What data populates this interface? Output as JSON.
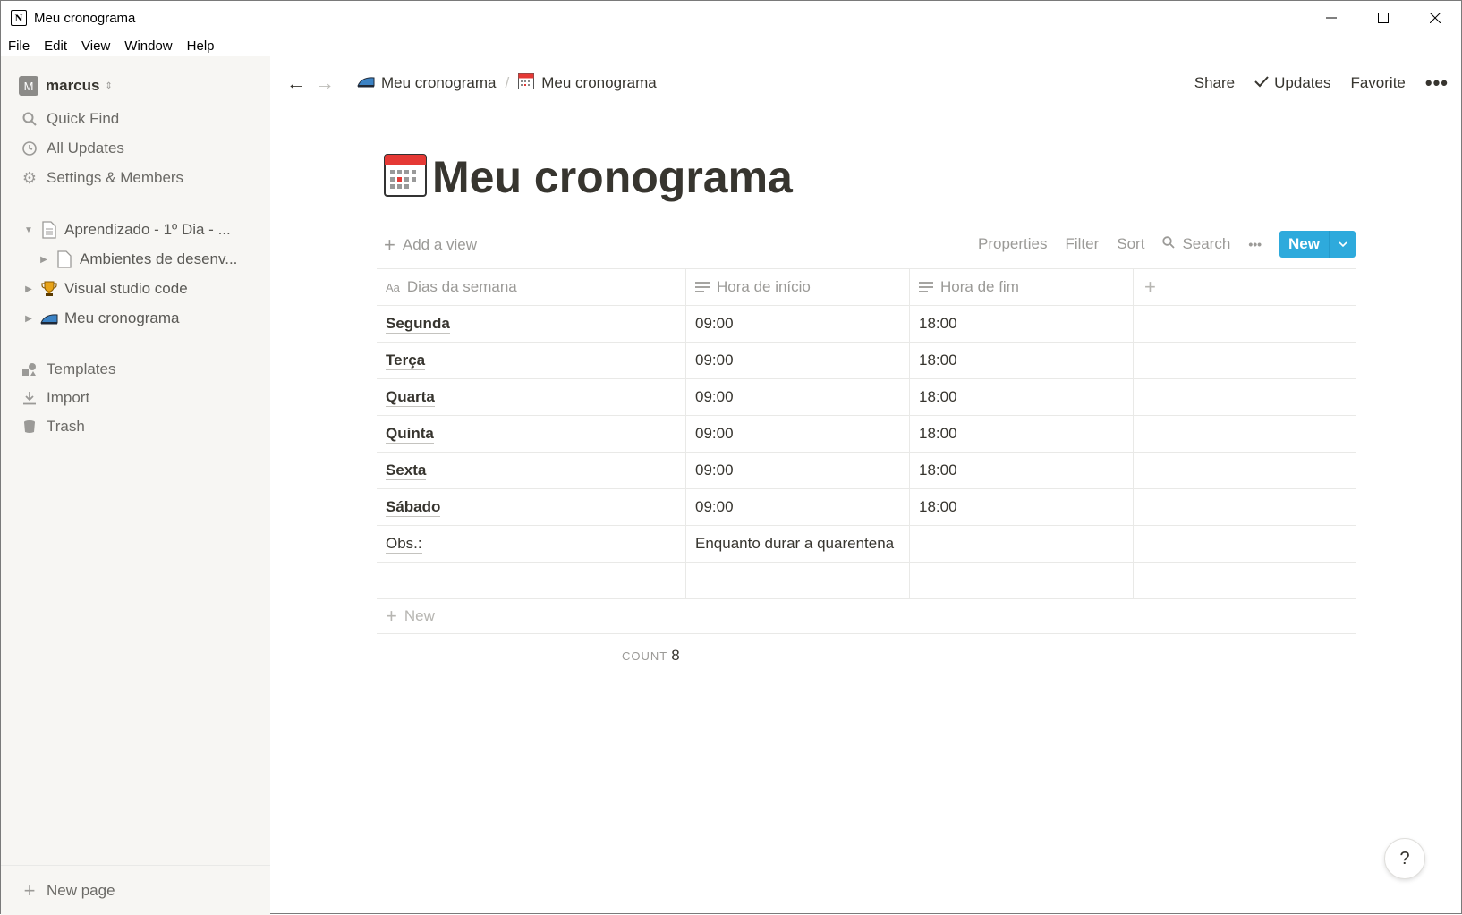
{
  "window": {
    "title": "Meu cronograma",
    "minimize": "—",
    "maximize": "☐",
    "close": "✕"
  },
  "menubar": [
    "File",
    "Edit",
    "View",
    "Window",
    "Help"
  ],
  "sidebar": {
    "workspace": {
      "initial": "M",
      "name": "marcus"
    },
    "nav": [
      {
        "label": "Quick Find",
        "icon": "search-icon"
      },
      {
        "label": "All Updates",
        "icon": "clock-icon"
      },
      {
        "label": "Settings & Members",
        "icon": "gear-icon"
      }
    ],
    "pages": [
      {
        "label": "Aprendizado - 1º Dia - ...",
        "icon": "document-icon",
        "expanded": true,
        "level": 0
      },
      {
        "label": "Ambientes de desenv...",
        "icon": "document-icon",
        "expanded": false,
        "level": 1
      },
      {
        "label": "Visual studio code",
        "icon": "trophy-icon",
        "expanded": false,
        "level": 0
      },
      {
        "label": "Meu cronograma",
        "icon": "iron-icon",
        "expanded": false,
        "level": 0
      }
    ],
    "tools": [
      {
        "label": "Templates",
        "icon": "templates-icon"
      },
      {
        "label": "Import",
        "icon": "import-icon"
      },
      {
        "label": "Trash",
        "icon": "trash-icon"
      }
    ],
    "new_page": "New page"
  },
  "topbar": {
    "breadcrumbs": [
      {
        "label": "Meu cronograma",
        "icon": "iron-icon"
      },
      {
        "label": "Meu cronograma",
        "icon": "calendar-icon"
      }
    ],
    "separator": "/",
    "share": "Share",
    "updates": "Updates",
    "favorite": "Favorite",
    "more": "•••"
  },
  "page": {
    "title": "Meu cronograma"
  },
  "toolbar": {
    "add_view": "Add a view",
    "properties": "Properties",
    "filter": "Filter",
    "sort": "Sort",
    "search": "Search",
    "more": "•••",
    "new": "New"
  },
  "table": {
    "columns": [
      "Dias da semana",
      "Hora de início",
      "Hora de fim"
    ],
    "rows": [
      [
        "Segunda",
        "09:00",
        "18:00"
      ],
      [
        "Terça",
        "09:00",
        "18:00"
      ],
      [
        "Quarta",
        "09:00",
        "18:00"
      ],
      [
        "Quinta",
        "09:00",
        "18:00"
      ],
      [
        "Sexta",
        "09:00",
        "18:00"
      ],
      [
        "Sábado",
        "09:00",
        "18:00"
      ],
      [
        "Obs.:",
        "Enquanto durar a quarentena",
        ""
      ],
      [
        "",
        "",
        ""
      ]
    ],
    "new_row": "New",
    "count_label": "COUNT",
    "count_value": "8"
  },
  "help": "?",
  "colors": {
    "accent": "#2eaadc",
    "sidebar_bg": "#f7f6f3",
    "text": "#37352f",
    "muted": "#9b9a97"
  }
}
